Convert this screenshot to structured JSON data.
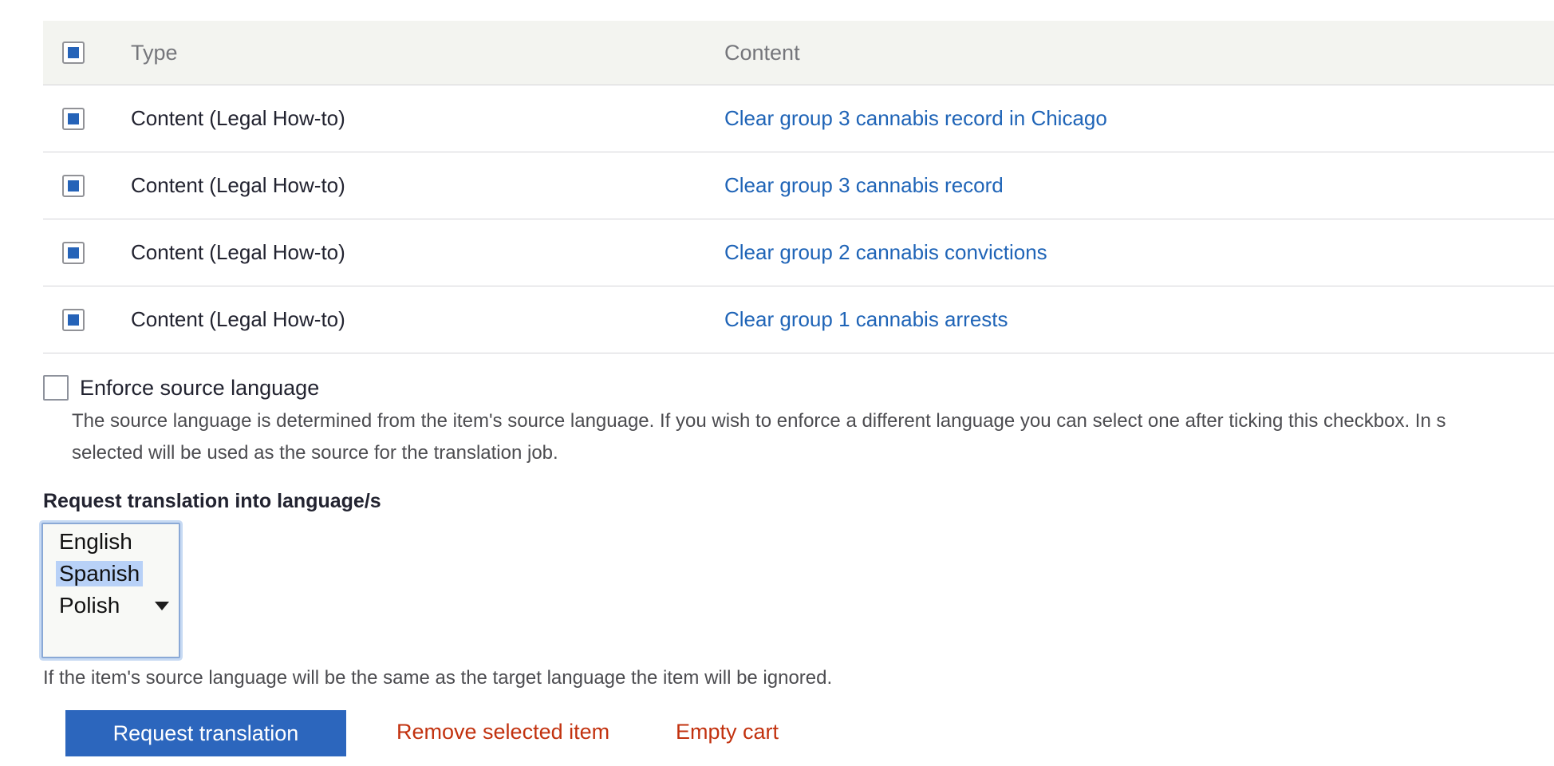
{
  "table": {
    "headers": {
      "type": "Type",
      "content": "Content"
    },
    "rows": [
      {
        "type": "Content (Legal How-to)",
        "content": "Clear group 3 cannabis record in Chicago"
      },
      {
        "type": "Content (Legal How-to)",
        "content": "Clear group 3 cannabis record"
      },
      {
        "type": "Content (Legal How-to)",
        "content": "Clear group 2 cannabis convictions"
      },
      {
        "type": "Content (Legal How-to)",
        "content": "Clear group 1 cannabis arrests"
      }
    ]
  },
  "enforce_source": {
    "label": "Enforce source language",
    "description": "The source language is determined from the item's source language. If you wish to enforce a different language you can select one after ticking this checkbox. In s",
    "description_line2": "selected will be used as the source for the translation job."
  },
  "request": {
    "label": "Request translation into language/s",
    "languages": [
      "English",
      "Spanish",
      "Polish"
    ],
    "selected": "Spanish",
    "hint": "If the item's source language will be the same as the target language the item will be ignored."
  },
  "actions": {
    "request_translation": "Request translation",
    "remove_selected": "Remove selected item",
    "empty_cart": "Empty cart"
  },
  "colors": {
    "link": "#1f64b7",
    "primary_button": "#2c66bd",
    "danger_link": "#c2320f"
  }
}
